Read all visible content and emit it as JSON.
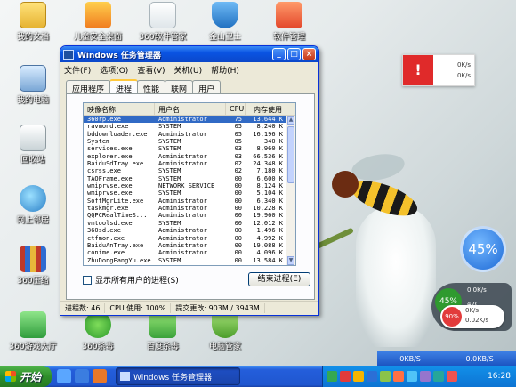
{
  "desktop": {
    "icons": [
      {
        "label": "我的文档",
        "icon": "folder-icon"
      },
      {
        "label": "我的电脑",
        "icon": "computer-icon"
      },
      {
        "label": "回收站",
        "icon": "recycle-bin-icon"
      },
      {
        "label": "网上邻居",
        "icon": "network-icon"
      },
      {
        "label": "360压缩",
        "icon": "archive-icon"
      },
      {
        "label": "360游戏大厅",
        "icon": "game-hall-icon"
      },
      {
        "label": "儿童安全桌面",
        "icon": "kids-safe-icon"
      },
      {
        "label": "360软件管家",
        "icon": "software-manager-icon"
      },
      {
        "label": "金山卫士",
        "icon": "shield-icon"
      },
      {
        "label": "软件管理",
        "icon": "software-icon"
      },
      {
        "label": "360杀毒",
        "icon": "antivirus-icon"
      },
      {
        "label": "百度杀毒",
        "icon": "baidu-antivirus-icon"
      },
      {
        "label": "电脑管家",
        "icon": "pc-guard-icon"
      }
    ]
  },
  "window": {
    "title": "Windows 任务管理器",
    "menu": [
      "文件(F)",
      "选项(O)",
      "查看(V)",
      "关机(U)",
      "帮助(H)"
    ],
    "tabs": [
      "应用程序",
      "进程",
      "性能",
      "联网",
      "用户"
    ],
    "active_tab": "进程",
    "columns": [
      "映像名称",
      "用户名",
      "CPU",
      "内存使用"
    ],
    "processes": [
      [
        "360rp.exe",
        "Administrator",
        "75",
        "13,644 K"
      ],
      [
        "ravmond.exe",
        "SYSTEM",
        "05",
        "8,240 K"
      ],
      [
        "bddownloader.exe",
        "Administrator",
        "05",
        "16,196 K"
      ],
      [
        "System",
        "SYSTEM",
        "05",
        "340 K"
      ],
      [
        "services.exe",
        "SYSTEM",
        "03",
        "8,960 K"
      ],
      [
        "explorer.exe",
        "Administrator",
        "03",
        "66,536 K"
      ],
      [
        "BaiduSdTray.exe",
        "Administrator",
        "02",
        "24,348 K"
      ],
      [
        "csrss.exe",
        "SYSTEM",
        "02",
        "7,180 K"
      ],
      [
        "TAOFrame.exe",
        "SYSTEM",
        "00",
        "6,600 K"
      ],
      [
        "wmiprvse.exe",
        "NETWORK SERVICE",
        "00",
        "8,124 K"
      ],
      [
        "wmiprvse.exe",
        "SYSTEM",
        "00",
        "5,104 K"
      ],
      [
        "SoftMgrLite.exe",
        "Administrator",
        "00",
        "6,340 K"
      ],
      [
        "taskmgr.exe",
        "Administrator",
        "00",
        "10,228 K"
      ],
      [
        "QQPCRealTimeS...",
        "Administrator",
        "00",
        "19,960 K"
      ],
      [
        "vmtoolsd.exe",
        "SYSTEM",
        "00",
        "12,012 K"
      ],
      [
        "360sd.exe",
        "Administrator",
        "00",
        "1,496 K"
      ],
      [
        "ctfmon.exe",
        "Administrator",
        "00",
        "4,992 K"
      ],
      [
        "BaiduAnTray.exe",
        "Administrator",
        "00",
        "19,088 K"
      ],
      [
        "conime.exe",
        "Administrator",
        "00",
        "4,096 K"
      ],
      [
        "ZhuDongFangYu.exe",
        "SYSTEM",
        "00",
        "13,584 K"
      ]
    ],
    "selected_row": 0,
    "show_all_label": "显示所有用户的进程(S)",
    "end_process_label": "结束进程(E)",
    "status": {
      "process_count": "进程数: 46",
      "cpu_usage": "CPU 使用: 100%",
      "commit": "提交更改: 903M / 3943M"
    }
  },
  "net_widget": {
    "up": "0K/s",
    "down": "0K/s"
  },
  "float_ball": {
    "percent": "45%"
  },
  "mini_panel": {
    "percent": "45%",
    "rate1": "0.0K/s",
    "rate2": "47C",
    "percent2": "90%",
    "rate3": "0K/s",
    "rate4": "0.02K/s"
  },
  "speedbar": {
    "down": "0KB/S",
    "up": "0.0KB/S"
  },
  "taskbar": {
    "start_label": "开始",
    "task_label": "Windows 任务管理器",
    "clock": "16:28"
  },
  "colors": {
    "selection": "#316ac5",
    "titlebar": "#0a54e3",
    "start": "#2f8f2b"
  }
}
